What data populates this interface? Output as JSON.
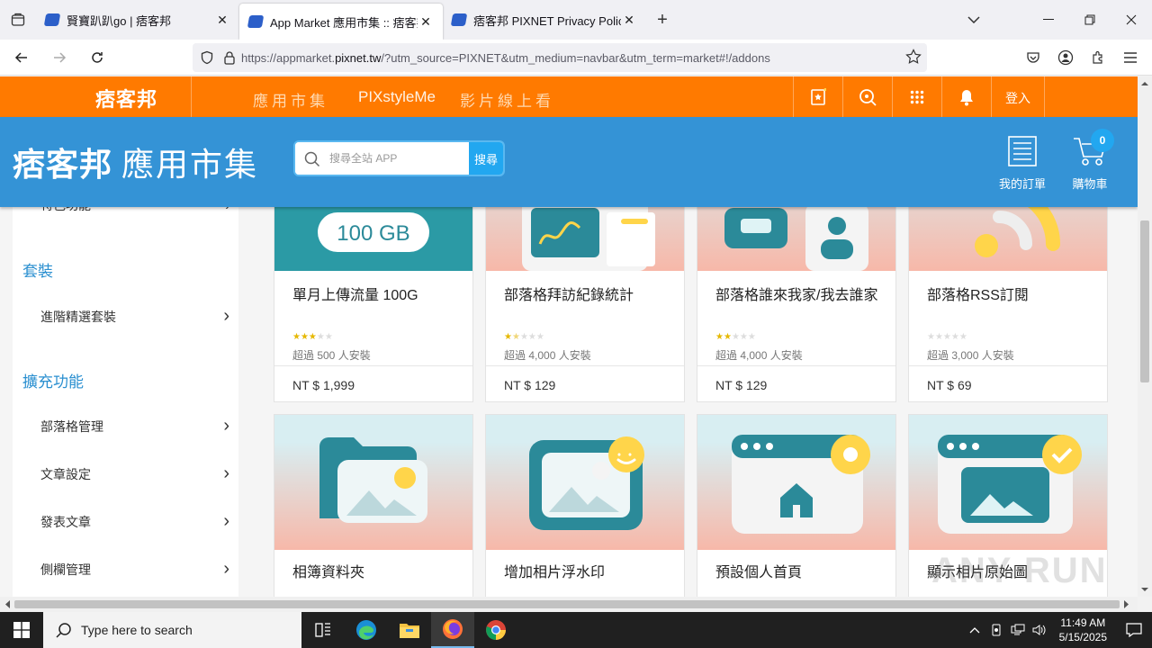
{
  "browser": {
    "tabs": [
      {
        "title": "賢寶趴趴go | 痞客邦",
        "active": false
      },
      {
        "title": "App Market 應用市集 :: 痞客邦",
        "active": true
      },
      {
        "title": "痞客邦 PIXNET Privacy Policy",
        "active": false
      }
    ],
    "url_prefix": "https://appmarket.",
    "url_domain": "pixnet.tw",
    "url_suffix": "/?utm_source=PIXNET&utm_medium=navbar&utm_term=market#!/addons"
  },
  "topnav": {
    "logo": "痞客邦",
    "items": [
      "應用市集",
      "PIXstyleMe",
      "影片線上看"
    ],
    "login": "登入"
  },
  "header": {
    "logo": "痞客邦",
    "title": "應用市集",
    "search_placeholder": "搜尋全站 APP",
    "search_button": "搜尋",
    "orders": "我的訂單",
    "cart": "購物車",
    "cart_count": "0"
  },
  "sidebar": {
    "partial_item": "特色功能",
    "sections": [
      {
        "title": "套裝",
        "items": [
          "進階精選套裝"
        ]
      },
      {
        "title": "擴充功能",
        "items": [
          "部落格管理",
          "文章設定",
          "發表文章",
          "側欄管理"
        ]
      }
    ]
  },
  "cards": [
    {
      "name": "單月上傳流量 100G",
      "stars": 3,
      "installs": "超過 500 人安裝",
      "price": "NT $ 1,999",
      "thumb_text": "100 GB"
    },
    {
      "name": "部落格拜訪紀錄統計",
      "stars": 1.5,
      "installs": "超過 4,000 人安裝",
      "price": "NT $ 129"
    },
    {
      "name": "部落格誰來我家/我去誰家",
      "stars": 2,
      "installs": "超過 4,000 人安裝",
      "price": "NT $ 129"
    },
    {
      "name": "部落格RSS訂閱",
      "stars": 0,
      "installs": "超過 3,000 人安裝",
      "price": "NT $ 69"
    },
    {
      "name": "相簿資料夾"
    },
    {
      "name": "增加相片浮水印"
    },
    {
      "name": "預設個人首頁"
    },
    {
      "name": "顯示相片原始圖"
    }
  ],
  "taskbar": {
    "search_placeholder": "Type here to search",
    "time": "11:49 AM",
    "date": "5/15/2025"
  },
  "watermark": "ANY RUN",
  "colors": {
    "orange": "#ff7a00",
    "blue": "#3493d6",
    "accent": "#22a7f0",
    "teal": "#2b8a99"
  }
}
